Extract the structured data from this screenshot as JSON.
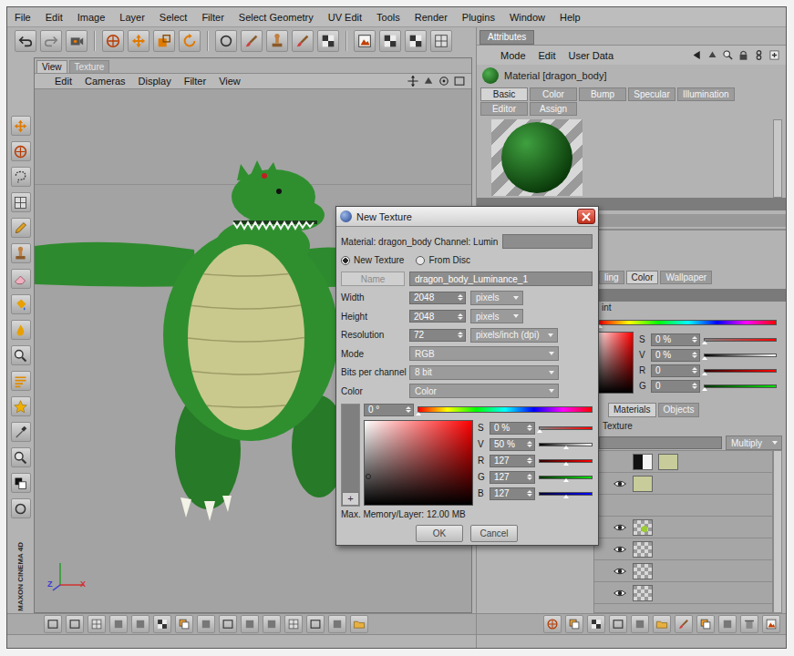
{
  "menu_bar": [
    "File",
    "Edit",
    "Image",
    "Layer",
    "Select",
    "Filter",
    "Select Geometry",
    "UV Edit",
    "Tools",
    "Render",
    "Plugins",
    "Window",
    "Help"
  ],
  "viewport": {
    "tabs": [
      {
        "label": "View",
        "selected": true
      },
      {
        "label": "Texture",
        "selected": false
      }
    ],
    "menu": [
      "Edit",
      "Cameras",
      "Display",
      "Filter",
      "View"
    ],
    "axes": [
      {
        "label": "Z",
        "color": "#3a3ad0"
      },
      {
        "label": "X",
        "color": "#d03030"
      }
    ],
    "logo": "MAXON CINEMA 4D"
  },
  "attributes": {
    "tab": "Attributes",
    "menu": [
      "Mode",
      "Edit",
      "User Data"
    ],
    "material": "Material [dragon_body]",
    "tab_rows": [
      [
        {
          "label": "Basic",
          "selected": true
        },
        {
          "label": "Color",
          "selected": false
        },
        {
          "label": "Bump",
          "selected": false
        },
        {
          "label": "Specular",
          "selected": false
        },
        {
          "label": "Illumination",
          "selected": false
        }
      ],
      [
        {
          "label": "Editor",
          "selected": false
        },
        {
          "label": "Assign",
          "selected": false
        }
      ]
    ]
  },
  "color_panel": {
    "tabs": [
      {
        "label": "ling",
        "selected": false
      },
      {
        "label": "Color",
        "selected": true
      },
      {
        "label": "Wallpaper",
        "selected": false
      }
    ],
    "heading": "int",
    "hue_level": 0,
    "sliders": [
      {
        "label": "S",
        "value": "0 %",
        "level": 0,
        "kind": "saturation"
      },
      {
        "label": "V",
        "value": "0 %",
        "level": 0,
        "kind": "value"
      },
      {
        "label": "R",
        "value": "0",
        "level": 0,
        "kind": "red"
      },
      {
        "label": "G",
        "value": "0",
        "level": 0,
        "kind": "green"
      }
    ]
  },
  "layers_panel": {
    "tabs": [
      {
        "label": "Materials",
        "selected": true
      },
      {
        "label": "Objects",
        "selected": false
      }
    ],
    "title": "Texture",
    "blend_mode": "Multiply",
    "layers": [
      {
        "visible": false,
        "kind": "mask"
      },
      {
        "visible": true,
        "kind": "fill"
      },
      {
        "visible": false,
        "kind": "blank"
      },
      {
        "visible": true,
        "kind": "paint"
      },
      {
        "visible": true,
        "kind": "checker"
      },
      {
        "visible": true,
        "kind": "checker"
      },
      {
        "visible": true,
        "kind": "checker"
      }
    ]
  },
  "dialog": {
    "title": "New Texture",
    "info": "Material: dragon_body Channel: Lumin",
    "source": [
      {
        "label": "New Texture",
        "selected": true
      },
      {
        "label": "From Disc",
        "selected": false
      }
    ],
    "name_button": {
      "label": "Name",
      "disabled": true
    },
    "name_value": "dragon_body_Luminance_1",
    "fields": [
      {
        "label": "Width",
        "value": "2048",
        "unit": "pixels"
      },
      {
        "label": "Height",
        "value": "2048",
        "unit": "pixels"
      },
      {
        "label": "Resolution",
        "value": "72",
        "unit": "pixels/inch (dpi)"
      }
    ],
    "dropdowns": [
      {
        "label": "Mode",
        "value": "RGB"
      },
      {
        "label": "Bits per channel",
        "value": "8 bit"
      },
      {
        "label": "Color",
        "value": "Color"
      }
    ],
    "hue": {
      "value": "0 °",
      "level": 0
    },
    "sliders": [
      {
        "label": "S",
        "value": "0 %",
        "level": 0,
        "kind": "saturation"
      },
      {
        "label": "V",
        "value": "50 %",
        "level": 0.5,
        "kind": "value"
      },
      {
        "label": "R",
        "value": "127",
        "level": 0.5,
        "kind": "red"
      },
      {
        "label": "G",
        "value": "127",
        "level": 0.5,
        "kind": "green"
      },
      {
        "label": "B",
        "value": "127",
        "level": 0.5,
        "kind": "blue"
      }
    ],
    "add_button": "+",
    "memory": "Max. Memory/Layer: 12.00 MB",
    "buttons": [
      "OK",
      "Cancel"
    ]
  }
}
